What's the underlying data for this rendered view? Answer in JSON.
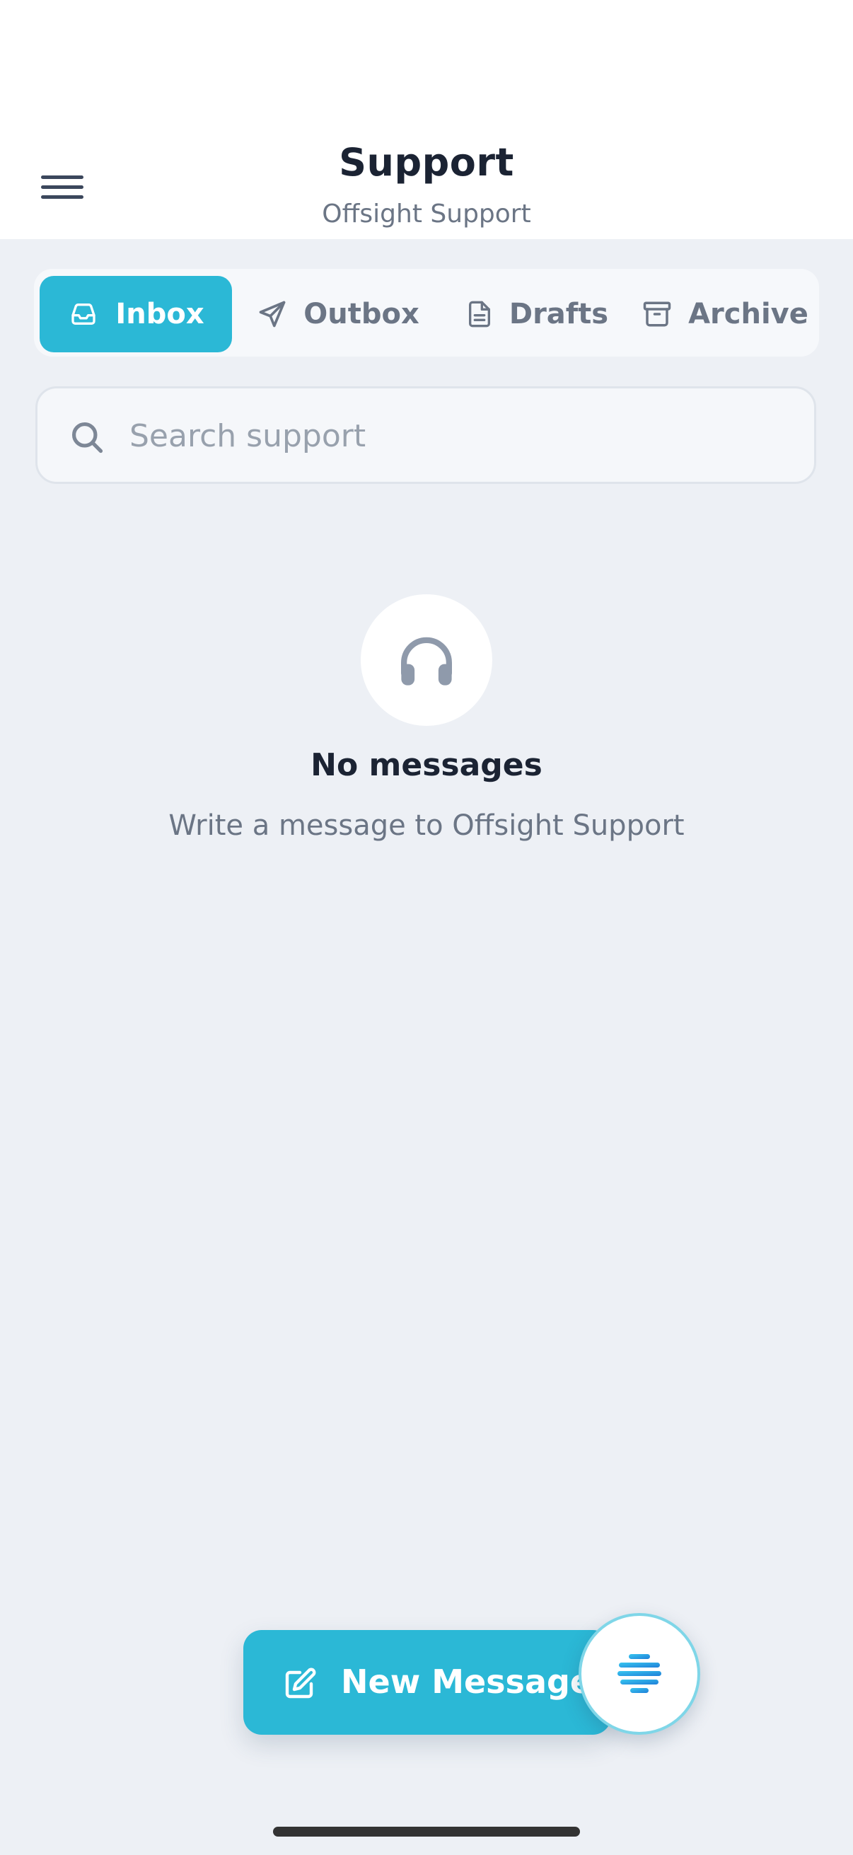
{
  "header": {
    "title": "Support",
    "subtitle": "Offsight Support",
    "menu_icon": "hamburger-menu-icon"
  },
  "tabs": [
    {
      "label": "Inbox",
      "icon": "inbox-tray-icon",
      "active": true
    },
    {
      "label": "Outbox",
      "icon": "send-arrow-icon",
      "active": false
    },
    {
      "label": "Drafts",
      "icon": "document-icon",
      "active": false
    },
    {
      "label": "Archive",
      "icon": "archive-box-icon",
      "active": false
    }
  ],
  "search": {
    "placeholder": "Search support",
    "value": "",
    "icon": "search-icon"
  },
  "empty_state": {
    "icon": "headphones-icon",
    "title": "No messages",
    "subtitle": "Write a message to Offsight Support"
  },
  "actions": {
    "new_message_label": "New Message",
    "new_message_icon": "edit-square-icon",
    "assistant_icon": "assistant-logo-icon"
  },
  "colors": {
    "accent": "#2bb8d6",
    "background": "#edf0f5",
    "text_primary": "#1b2333",
    "text_secondary": "#6b7585"
  }
}
